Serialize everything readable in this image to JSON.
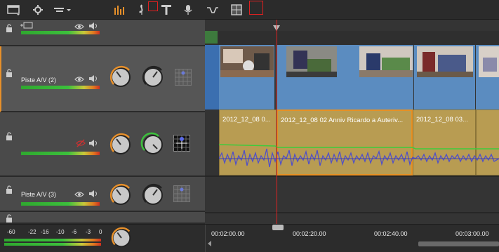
{
  "toolbar": {
    "icons": [
      "panel-layout-icon",
      "settings-gear-icon",
      "dropdown-menu-icon",
      "audio-mixer-icon",
      "music-note-icon",
      "title-icon",
      "voice-microphone-icon",
      "transition-icon",
      "split-screen-icon",
      "stop-marker-icon"
    ]
  },
  "tracks": [
    {
      "name": "",
      "meter_level": 0.95
    },
    {
      "name": "Piste A/V (2)",
      "meter_level": 0.98,
      "selected": true
    },
    {
      "name": "",
      "meter_level": 0.98,
      "muted_video": true
    },
    {
      "name": "Piste A/V (3)",
      "meter_level": 0.98
    }
  ],
  "clips": {
    "audio": [
      {
        "label": "2012_12_08 0..."
      },
      {
        "label": "2012_12_08 02 Anniv Ricardo a Auteriv..."
      },
      {
        "label": "2012_12_08 03..."
      }
    ]
  },
  "master": {
    "scale": [
      "-60",
      "-22",
      "-16",
      "-10",
      "-6",
      "-3",
      "0"
    ]
  },
  "ruler": {
    "timecodes": [
      "00:02:00.00",
      "00:02:20.00",
      "00:02:40.00",
      "00:03:00.00"
    ]
  },
  "colors": {
    "playhead": "#dd2222",
    "selection": "#e8902a",
    "video_clip": "#5b8cc0",
    "audio_clip": "#b89c52"
  }
}
